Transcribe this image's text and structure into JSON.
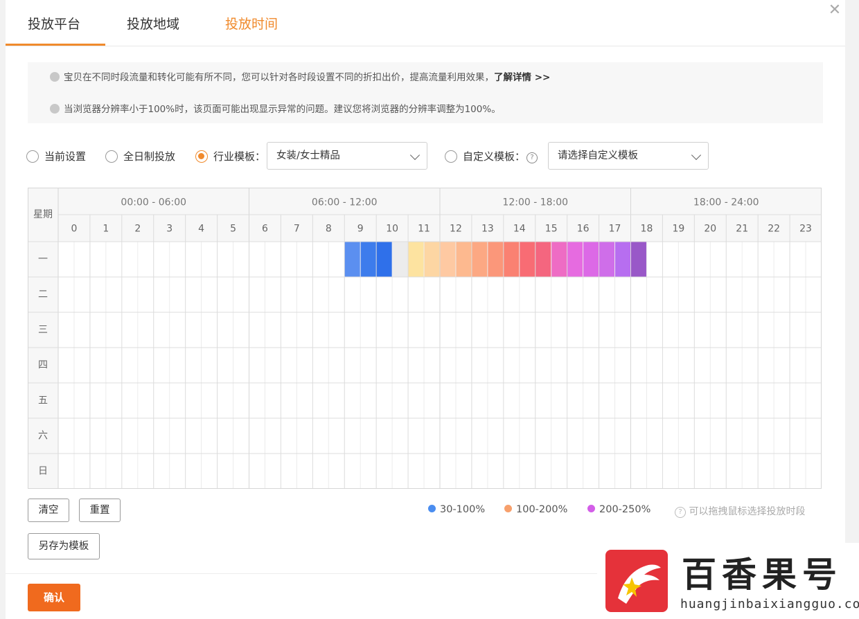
{
  "tabs": [
    {
      "label": "投放平台",
      "active": false
    },
    {
      "label": "投放地域",
      "active": false
    },
    {
      "label": "投放时间",
      "active": true
    }
  ],
  "close_icon": "close-icon",
  "notices": [
    {
      "text": "宝贝在不同时段流量和转化可能有所不同，您可以针对各时段设置不同的折扣出价，提高流量利用效果，",
      "link": "了解详情 >>"
    },
    {
      "text": "当浏览器分辨率小于100%时，该页面可能出现显示异常的问题。建议您将浏览器的分辨率调整为100%。",
      "link": ""
    }
  ],
  "options": {
    "current": "当前设置",
    "allday": "全日制投放",
    "industry": "行业模板：",
    "industry_value": "女装/女士精品",
    "custom": "自定义模板：",
    "custom_placeholder": "请选择自定义模板",
    "selected": "industry"
  },
  "schedule": {
    "day_header": "星期",
    "time_ranges": [
      "00:00 - 06:00",
      "06:00 - 12:00",
      "12:00 - 18:00",
      "18:00 - 24:00"
    ],
    "hours": [
      "0",
      "1",
      "2",
      "3",
      "4",
      "5",
      "6",
      "7",
      "8",
      "9",
      "10",
      "11",
      "12",
      "13",
      "14",
      "15",
      "16",
      "17",
      "18",
      "19",
      "20",
      "21",
      "22",
      "23"
    ],
    "days": [
      "一",
      "二",
      "三",
      "四",
      "五",
      "六",
      "日"
    ],
    "filled": [
      {
        "day": 0,
        "half": 18,
        "color": "#5b8ff0"
      },
      {
        "day": 0,
        "half": 19,
        "color": "#3d7cec"
      },
      {
        "day": 0,
        "half": 20,
        "color": "#2f70ea"
      },
      {
        "day": 0,
        "half": 21,
        "color": "#ececec"
      },
      {
        "day": 0,
        "half": 22,
        "color": "#fde3a0"
      },
      {
        "day": 0,
        "half": 23,
        "color": "#fdd6a3"
      },
      {
        "day": 0,
        "half": 24,
        "color": "#fec9a2"
      },
      {
        "day": 0,
        "half": 25,
        "color": "#fdb98f"
      },
      {
        "day": 0,
        "half": 26,
        "color": "#fca883"
      },
      {
        "day": 0,
        "half": 27,
        "color": "#fb977a"
      },
      {
        "day": 0,
        "half": 28,
        "color": "#fa8172"
      },
      {
        "day": 0,
        "half": 29,
        "color": "#f86c74"
      },
      {
        "day": 0,
        "half": 30,
        "color": "#f4667f"
      },
      {
        "day": 0,
        "half": 31,
        "color": "#ee6cc4"
      },
      {
        "day": 0,
        "half": 32,
        "color": "#e66be0"
      },
      {
        "day": 0,
        "half": 33,
        "color": "#dc69e6"
      },
      {
        "day": 0,
        "half": 34,
        "color": "#cf6ee9"
      },
      {
        "day": 0,
        "half": 35,
        "color": "#b76ef0"
      },
      {
        "day": 0,
        "half": 36,
        "color": "#9958c8"
      }
    ]
  },
  "buttons": {
    "clear": "清空",
    "reset": "重置",
    "save_template": "另存为模板",
    "confirm": "确认"
  },
  "legend": [
    {
      "label": "30-100%",
      "color": "#4a8df0"
    },
    {
      "label": "100-200%",
      "color": "#f7a06c"
    },
    {
      "label": "200-250%",
      "color": "#d35ee8"
    }
  ],
  "legend_note": "可以拖拽鼠标选择投放时段",
  "watermark": {
    "title": "百香果号",
    "url": "huangjinbaixiangguo.com"
  }
}
